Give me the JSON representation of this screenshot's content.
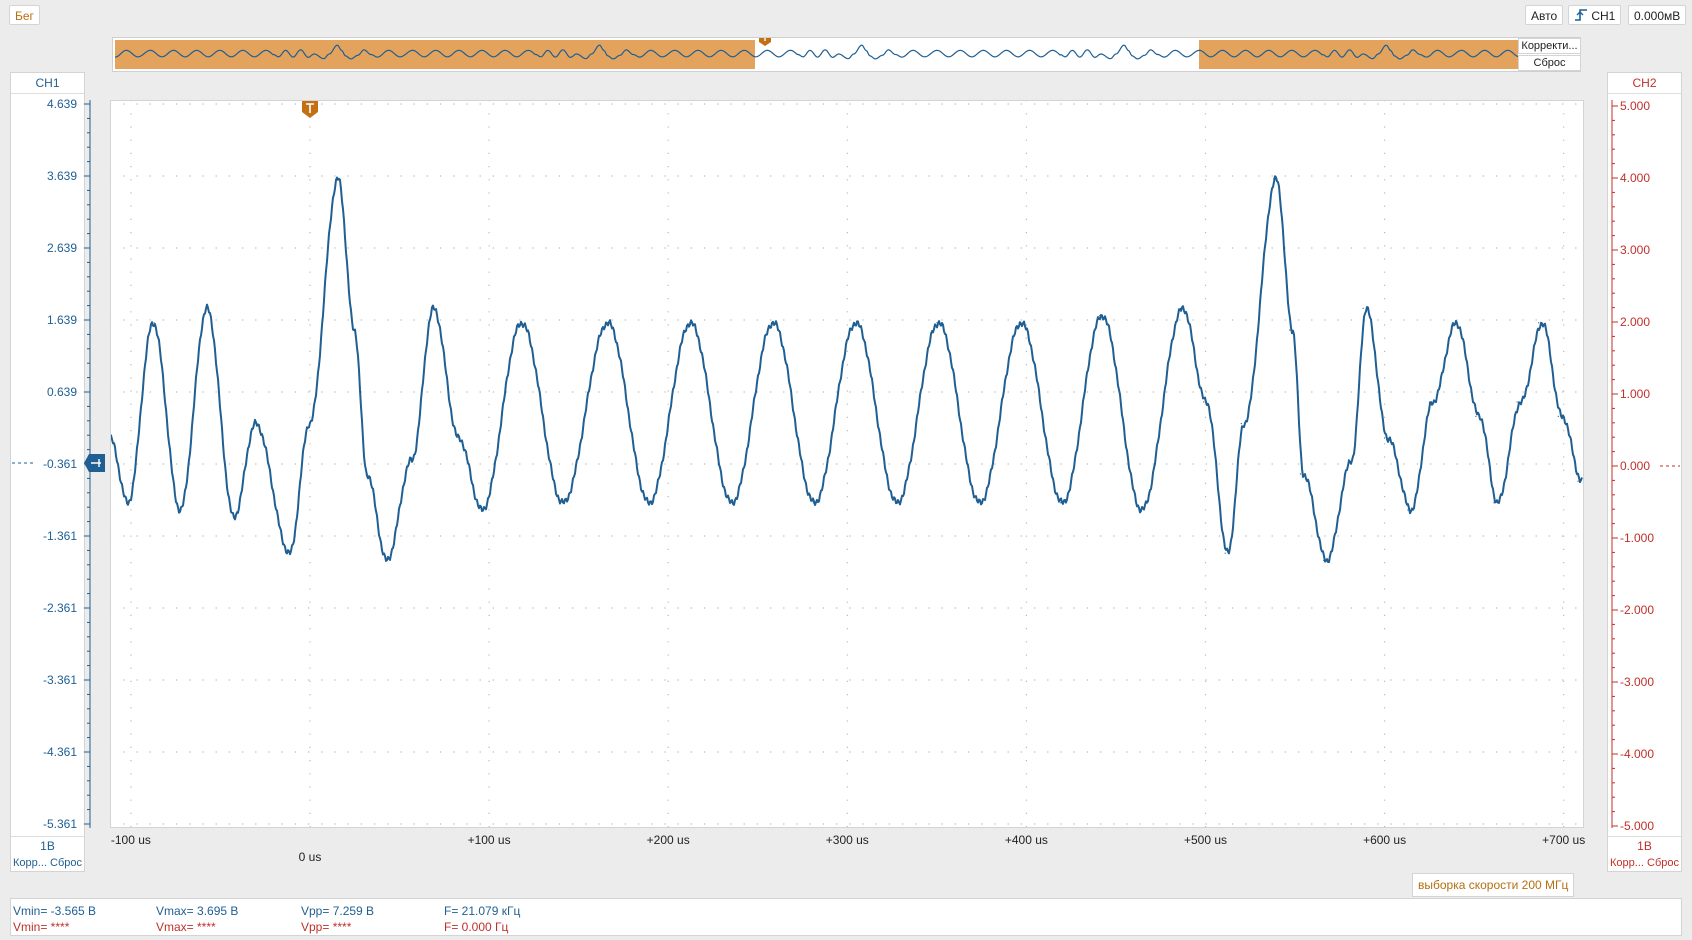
{
  "top_bar": {
    "status_label": "Бег",
    "mode_label": "Авто",
    "trigger_channel": "CH1",
    "trigger_level": "0.000мВ"
  },
  "overview": {
    "correct_label": "Корректи...",
    "reset_label": "Сброс",
    "trigger_marker": "T"
  },
  "ch1": {
    "name": "CH1",
    "volts_per_div": "1В",
    "footer": "Корр... Сброс",
    "color": "#1f5f93",
    "y_ticks": [
      "4.639",
      "3.639",
      "2.639",
      "1.639",
      "0.639",
      "-0.361",
      "-1.361",
      "-2.361",
      "-3.361",
      "-4.361",
      "-5.361"
    ]
  },
  "ch2": {
    "name": "CH2",
    "volts_per_div": "1В",
    "footer": "Корр... Сброс",
    "color": "#c0302b",
    "y_ticks": [
      "5.000",
      "4.000",
      "3.000",
      "2.000",
      "1.000",
      "0.000",
      "-1.000",
      "-2.000",
      "-3.000",
      "-4.000",
      "-5.000"
    ]
  },
  "time_axis": {
    "labels": [
      "-100 us",
      "0 us",
      "+100 us",
      "+200 us",
      "+300 us",
      "+400 us",
      "+500 us",
      "+600 us",
      "+700 us"
    ]
  },
  "sample_rate_label": "выборка скорости 200 МГц",
  "measurements": {
    "ch1": {
      "vmin": "Vmin= -3.565 В",
      "vmax": "Vmax= 3.695 В",
      "vpp": "Vpp= 7.259 В",
      "freq": "F= 21.079 кГц"
    },
    "ch2": {
      "vmin": "Vmin= ****",
      "vmax": "Vmax= ****",
      "vpp": "Vpp= ****",
      "freq": "F= 0.000 Гц"
    }
  },
  "chart_data": {
    "type": "line",
    "xlabel": "",
    "ylabel": "",
    "xlim": [
      -111,
      708
    ],
    "ylim": [
      -5.361,
      4.639
    ],
    "x_ticks": [
      -100,
      0,
      100,
      200,
      300,
      400,
      500,
      600,
      700
    ],
    "grid": true,
    "series": [
      {
        "name": "CH1",
        "color": "#1f5f93",
        "points": [
          [
            -111,
            0.0
          ],
          [
            -101,
            -0.9
          ],
          [
            -87,
            1.6
          ],
          [
            -72,
            -1.0
          ],
          [
            -57,
            1.8
          ],
          [
            -42,
            -1.1
          ],
          [
            -30,
            0.2
          ],
          [
            -11,
            -1.6
          ],
          [
            0,
            0.2
          ],
          [
            16,
            3.6
          ],
          [
            25,
            1.5
          ],
          [
            32,
            -0.5
          ],
          [
            43,
            -1.7
          ],
          [
            57,
            -0.3
          ],
          [
            69,
            1.8
          ],
          [
            83,
            0.0
          ],
          [
            96,
            -1.0
          ],
          [
            118,
            1.6
          ],
          [
            141,
            -0.9
          ],
          [
            166,
            1.6
          ],
          [
            189,
            -0.9
          ],
          [
            212,
            1.6
          ],
          [
            235,
            -0.9
          ],
          [
            258,
            1.6
          ],
          [
            281,
            -0.9
          ],
          [
            304,
            1.6
          ],
          [
            327,
            -0.9
          ],
          [
            350,
            1.6
          ],
          [
            373,
            -0.9
          ],
          [
            396,
            1.6
          ],
          [
            419,
            -0.9
          ],
          [
            441,
            1.7
          ],
          [
            463,
            -1.0
          ],
          [
            486,
            1.8
          ],
          [
            499,
            0.5
          ],
          [
            511,
            -1.6
          ],
          [
            520,
            0.2
          ],
          [
            538,
            3.6
          ],
          [
            547,
            1.5
          ],
          [
            553,
            -0.5
          ],
          [
            566,
            -1.7
          ],
          [
            580,
            -0.3
          ],
          [
            588,
            1.8
          ],
          [
            600,
            0.0
          ],
          [
            613,
            -1.0
          ],
          [
            625,
            0.5
          ],
          [
            638,
            1.6
          ],
          [
            651,
            0.3
          ],
          [
            661,
            -0.9
          ],
          [
            674,
            0.5
          ],
          [
            686,
            1.6
          ],
          [
            697,
            0.3
          ],
          [
            708,
            -0.6
          ]
        ]
      }
    ]
  }
}
